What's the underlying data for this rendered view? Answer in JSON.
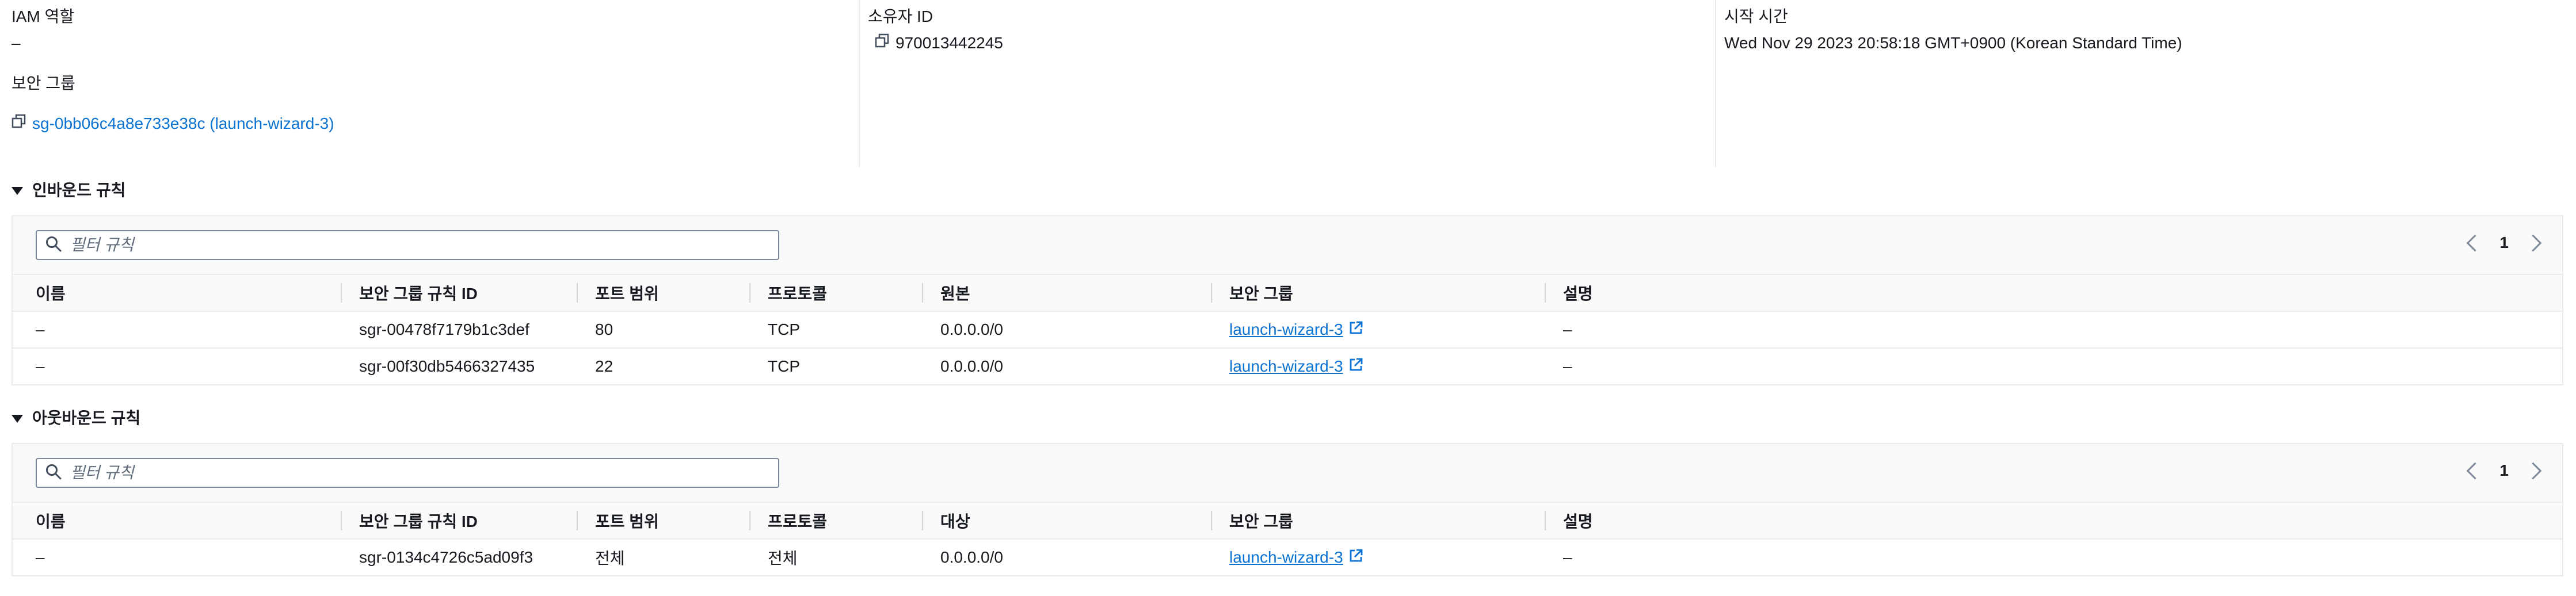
{
  "details": {
    "iam_role": {
      "label": "IAM 역할",
      "value": "–"
    },
    "owner_id": {
      "label": "소유자 ID",
      "value": "970013442245"
    },
    "launch_time": {
      "label": "시작 시간",
      "value": "Wed Nov 29 2023 20:58:18 GMT+0900 (Korean Standard Time)"
    },
    "security_group": {
      "label": "보안 그룹",
      "value": "sg-0bb06c4a8e733e38c (launch-wizard-3)"
    }
  },
  "inbound": {
    "title": "인바운드 규칙",
    "filter_placeholder": "필터 규칙",
    "page": "1",
    "columns": [
      "이름",
      "보안 그룹 규칙 ID",
      "포트 범위",
      "프로토콜",
      "원본",
      "보안 그룹",
      "설명"
    ],
    "rows": [
      {
        "name": "–",
        "rule_id": "sgr-00478f7179b1c3def",
        "port": "80",
        "protocol": "TCP",
        "source": "0.0.0.0/0",
        "sg": "launch-wizard-3",
        "desc": "–"
      },
      {
        "name": "–",
        "rule_id": "sgr-00f30db5466327435",
        "port": "22",
        "protocol": "TCP",
        "source": "0.0.0.0/0",
        "sg": "launch-wizard-3",
        "desc": "–"
      }
    ]
  },
  "outbound": {
    "title": "아웃바운드 규칙",
    "filter_placeholder": "필터 규칙",
    "page": "1",
    "columns": [
      "이름",
      "보안 그룹 규칙 ID",
      "포트 범위",
      "프로토콜",
      "대상",
      "보안 그룹",
      "설명"
    ],
    "rows": [
      {
        "name": "–",
        "rule_id": "sgr-0134c4726c5ad09f3",
        "port": "전체",
        "protocol": "전체",
        "source": "0.0.0.0/0",
        "sg": "launch-wizard-3",
        "desc": "–"
      }
    ]
  },
  "colors": {
    "link": "#0972d3",
    "text": "#16191f",
    "border": "#e9ebed"
  }
}
